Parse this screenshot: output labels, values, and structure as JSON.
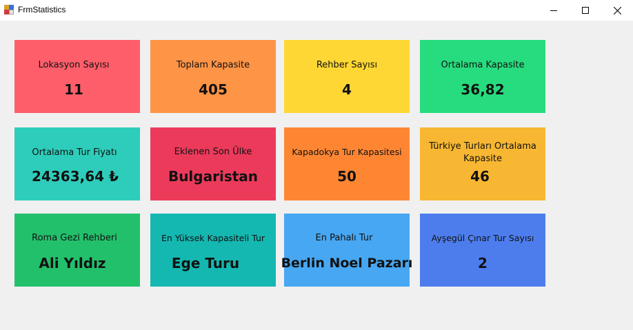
{
  "window": {
    "title": "FrmStatistics",
    "icon": "app-form-icon"
  },
  "colors": {
    "red": "#fe5e6a",
    "orange": "#fd9446",
    "yellow": "#fed734",
    "green": "#27dc7e",
    "teal": "#2ecdbb",
    "crimson": "#ec3a5b",
    "dark_orange": "#fe8633",
    "amber": "#f8b732",
    "dark_green": "#23c06c",
    "dark_teal": "#14b8b1",
    "sky_blue": "#47a7f2",
    "royal_blue": "#4d7ded"
  },
  "cards": [
    {
      "label": "Lokasyon Sayısı",
      "value": "11"
    },
    {
      "label": "Toplam Kapasite",
      "value": "405"
    },
    {
      "label": "Rehber Sayısı",
      "value": "4"
    },
    {
      "label": "Ortalama Kapasite",
      "value": "36,82"
    },
    {
      "label": "Ortalama Tur Fiyatı",
      "value": "24363,64 ₺"
    },
    {
      "label": "Eklenen Son Ülke",
      "value": "Bulgaristan"
    },
    {
      "label": "Kapadokya Tur Kapasitesi",
      "value": "50"
    },
    {
      "label": "Türkiye Turları Ortalama Kapasite",
      "value": "46"
    },
    {
      "label": "Roma Gezi Rehberi",
      "value": "Ali Yıldız"
    },
    {
      "label": "En Yüksek Kapasiteli Tur",
      "value": "Ege Turu"
    },
    {
      "label": "En Pahalı Tur",
      "value": "Berlin Noel Pazarı"
    },
    {
      "label": "Ayşegül Çınar Tur Sayısı",
      "value": "2"
    }
  ]
}
